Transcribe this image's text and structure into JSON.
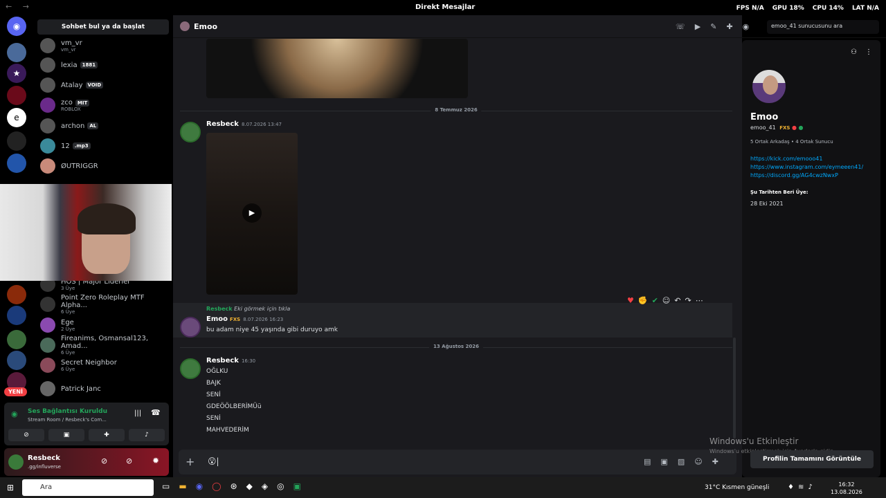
{
  "window": {
    "title": "Direkt Mesajlar",
    "nav": "← →"
  },
  "stats": {
    "fps": "FPS N/A",
    "gpu": "GPU 18%",
    "cpu": "CPU 14%",
    "lat": "LAT N/A"
  },
  "left": {
    "search_button": "Sohbet bul ya da başlat",
    "dms": [
      {
        "name": "vm_vr",
        "sub": "vm_vr",
        "tag": ""
      },
      {
        "name": "lexia",
        "sub": "",
        "tag": "1881"
      },
      {
        "name": "Atalay",
        "sub": "",
        "tag": "VOID"
      },
      {
        "name": "zco",
        "sub": "ROBLOX",
        "tag": "MIT"
      },
      {
        "name": "archon",
        "sub": "",
        "tag": "AL"
      },
      {
        "name": "12",
        "sub": "",
        "tag": ".mp3"
      },
      {
        "name": "ØUTRIGGR",
        "sub": "",
        "tag": ""
      },
      {
        "name": "HOS | Major Liderler",
        "sub": "3 Üye",
        "tag": ""
      },
      {
        "name": "Point Zero Roleplay MTF Alpha...",
        "sub": "6 Üye",
        "tag": ""
      },
      {
        "name": "Ege",
        "sub": "2 Üye",
        "tag": ""
      },
      {
        "name": "Fireanims, Osmansal123, Amad...",
        "sub": "6 Üye",
        "tag": ""
      },
      {
        "name": "Secret Neighbor",
        "sub": "6 Üye",
        "tag": ""
      },
      {
        "name": "Patrick Janc",
        "sub": "",
        "tag": ""
      }
    ],
    "yeni": "YENİ",
    "voice": {
      "status": "Ses Bağlantısı Kuruldu",
      "room": "Stream Room / Resbeck's Com..."
    },
    "user": {
      "name": "Resbeck",
      "status": ".gg/influverse"
    }
  },
  "chat": {
    "recipient": "Emoo",
    "search_placeholder": "emoo_41 sunucusunu ara",
    "date1": "8 Temmuz 2026",
    "date2": "13 Ağustos 2026",
    "msg1": {
      "author": "Resbeck",
      "ts": "8.07.2026 13:47"
    },
    "reply_ref": {
      "author": "Resbeck",
      "text": "Eki görmek için tıkla"
    },
    "msg2": {
      "author": "Emoo",
      "tag": "FXS",
      "ts": "8.07.2026 16:23",
      "text": "bu adam niye 45 yaşında gibi duruyo amk"
    },
    "msg3": {
      "author": "Resbeck",
      "ts": "16:30",
      "lines": [
        "OĞLKU",
        "BAJK",
        "SENİ",
        "GDEÖÖLBERİMÜü",
        "SENİ",
        "MAHVEDERİM"
      ]
    },
    "composer_value": "😮|"
  },
  "profile": {
    "name": "Emoo",
    "username": "emoo_41",
    "tag": "FXS",
    "mutual": "5 Ortak Arkadaş • 4 Ortak Sunucu",
    "links": [
      "https://kick.com/emooo41",
      "https://www.instagram.com/eymeeen41/",
      "https://discord.gg/AG4cwzNwxP"
    ],
    "member_since_label": "Şu Tarihten Beri Üye:",
    "member_since": "28 Eki 2021",
    "full_profile_button": "Profilin Tamamını Görüntüle"
  },
  "watermark": {
    "title": "Windows'u Etkinleştir",
    "sub": "Windows'u etkinleştirmek için Ayarlar'a gidin."
  },
  "taskbar": {
    "search": "Ara",
    "weather": "31°C  Kısmen güneşli",
    "time": "16:32",
    "date": "13.08.2026"
  }
}
